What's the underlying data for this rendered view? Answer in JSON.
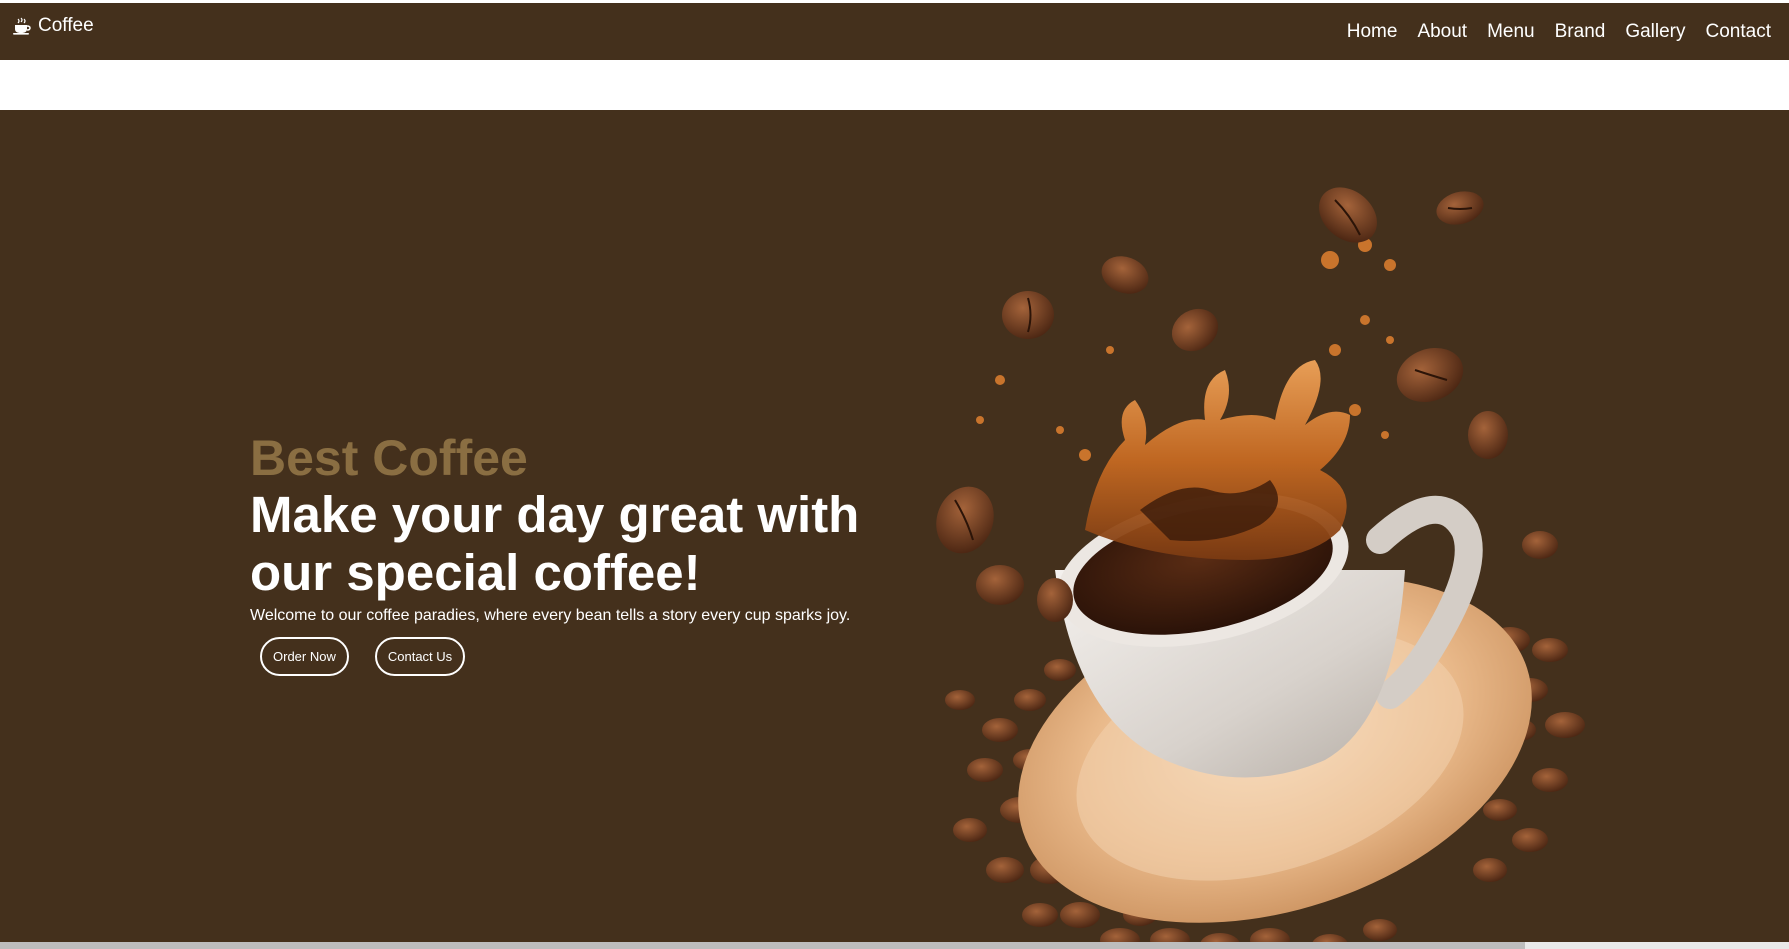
{
  "navbar": {
    "brand_label": "Coffee",
    "brand_icon": "coffee-cup-icon",
    "links": [
      "Home",
      "About",
      "Menu",
      "Brand",
      "Gallery",
      "Contact"
    ]
  },
  "hero": {
    "kicker": "Best Coffee",
    "headline_line1": "Make your day great with",
    "headline_line2": "our special coffee!",
    "subtitle": "Welcome to our coffee paradies, where every bean tells a story every cup sparks joy.",
    "buttons": {
      "order": "Order Now",
      "contact": "Contact Us"
    }
  },
  "colors": {
    "navbar_bg": "#44301c",
    "hero_bg": "#44301c",
    "kicker": "#8a6e42",
    "text": "#ffffff"
  }
}
